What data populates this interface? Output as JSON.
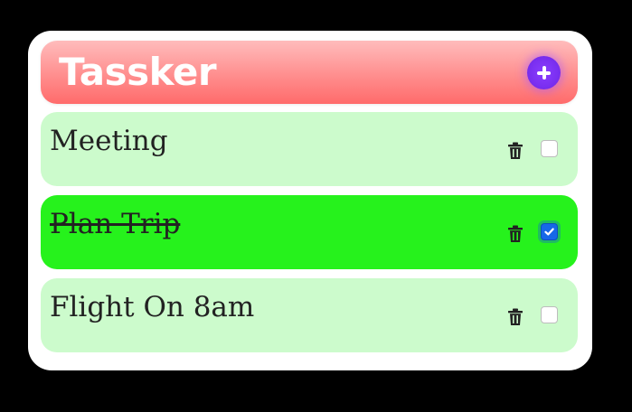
{
  "app": {
    "title": "Tassker"
  },
  "header": {
    "add_icon": "plus-icon"
  },
  "tasks": [
    {
      "text": "Meeting",
      "completed": false
    },
    {
      "text": "Plan Trip",
      "completed": true
    },
    {
      "text": "Flight On 8am",
      "completed": false
    }
  ],
  "icons": {
    "delete": "trash-icon",
    "check": "check-icon"
  },
  "colors": {
    "background": "#000000",
    "card": "#ffffff",
    "header_gradient_top": "#ffbcbc",
    "header_gradient_bottom": "#ff6b6b",
    "add_button": "#7a2ff0",
    "task_pending": "#ccfbcc",
    "task_done": "#26f21c",
    "checkbox_checked": "#1668e8"
  }
}
